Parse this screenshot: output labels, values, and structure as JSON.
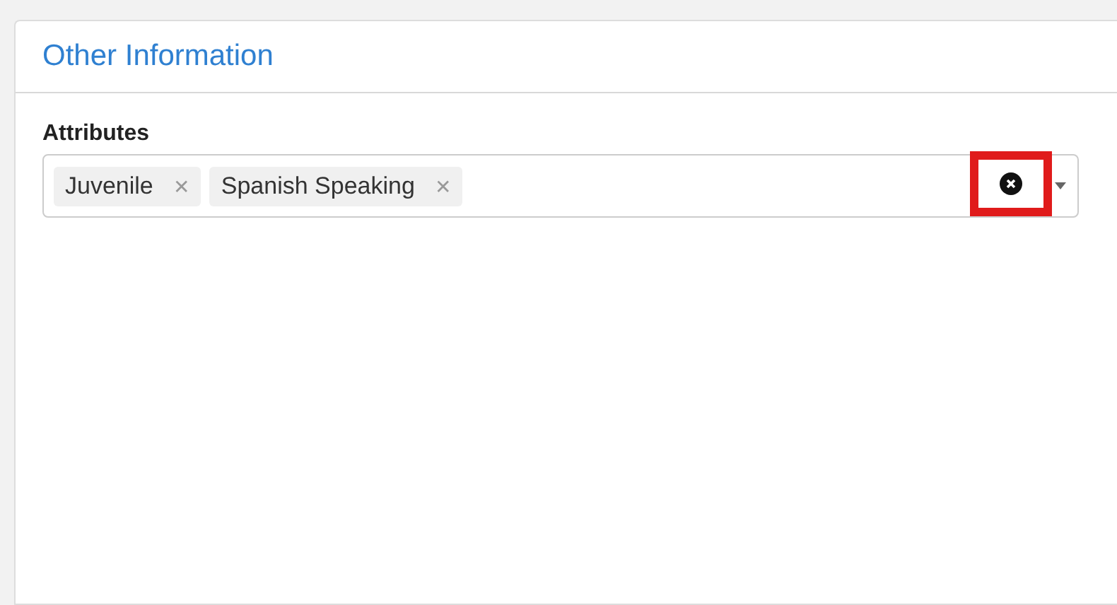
{
  "panel": {
    "title": "Other Information"
  },
  "attributes": {
    "label": "Attributes",
    "tags": [
      {
        "label": "Juvenile",
        "remove": "✕"
      },
      {
        "label": "Spanish Speaking",
        "remove": "✕"
      }
    ],
    "clear_button": {
      "highlighted": true
    }
  }
}
